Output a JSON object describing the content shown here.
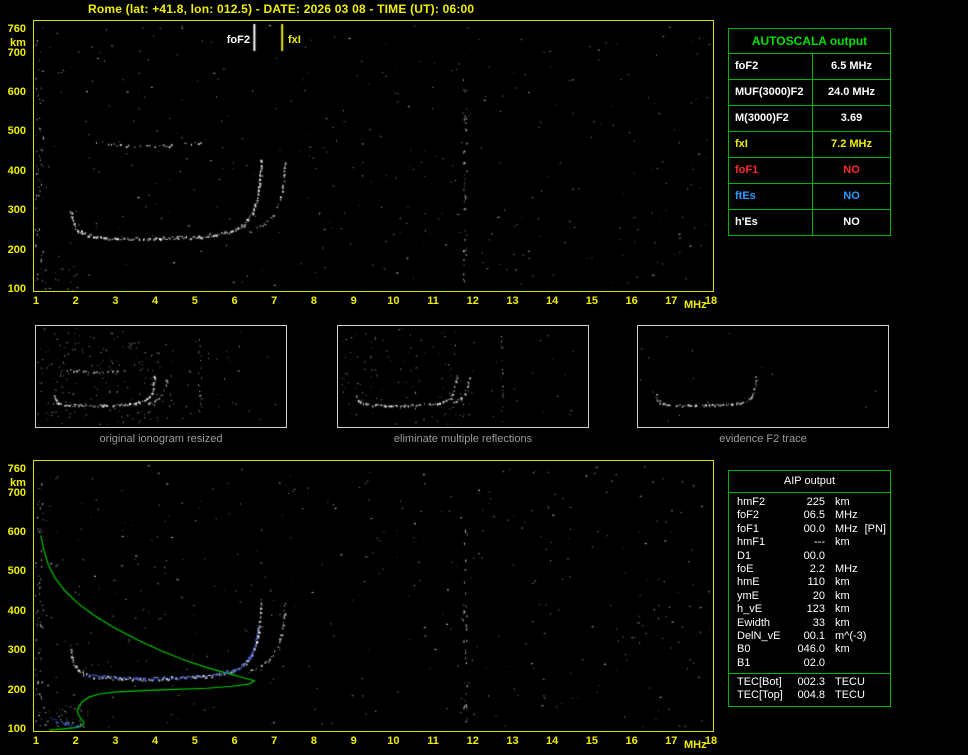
{
  "window": {
    "title": "Rome (lat: +41.8, lon: 012.5) - DATE: 2026 03 08 - TIME (UT): 06:00"
  },
  "colors": {
    "axis_yellow": "#f0f000",
    "panel_border": "#dede00",
    "table_green": "#00b400",
    "trace_white": "#ffffff",
    "profile_green": "#00c800",
    "restored_blue": "#3a5fff",
    "caption_gray": "#9c9c9c"
  },
  "axes": {
    "x_ticks": [
      1,
      2,
      3,
      4,
      5,
      6,
      7,
      8,
      9,
      10,
      11,
      12,
      13,
      14,
      15,
      16,
      17,
      18
    ],
    "x_unit": "MHz",
    "y_ticks": [
      760,
      700,
      600,
      500,
      400,
      300,
      200,
      100
    ],
    "y_unit": "km",
    "x_range": [
      1,
      18
    ],
    "y_range": [
      100,
      760
    ]
  },
  "autoscala": {
    "title": "AUTOSCALA output",
    "rows": [
      {
        "label": "foF2",
        "value": "6.5 MHz",
        "color": "#ffffff"
      },
      {
        "label": "MUF(3000)F2",
        "value": "24.0 MHz",
        "color": "#ffffff"
      },
      {
        "label": "M(3000)F2",
        "value": "3.69",
        "color": "#ffffff"
      },
      {
        "label": "fxI",
        "value": "7.2 MHz",
        "color": "#f0f000"
      },
      {
        "label": "foF1",
        "value": "NO",
        "color": "#ff2a2a"
      },
      {
        "label": "ftEs",
        "value": "NO",
        "color": "#2e9bff"
      },
      {
        "label": "h'Es",
        "value": "NO",
        "color": "#ffffff"
      }
    ]
  },
  "thumbnails": [
    {
      "caption": "original ionogram resized"
    },
    {
      "caption": "eliminate multiple reflections"
    },
    {
      "caption": "evidence F2 trace"
    }
  ],
  "aip": {
    "title": "AIP output",
    "rows": [
      {
        "name": "hmF2",
        "value": "225",
        "unit": "km",
        "extra": ""
      },
      {
        "name": "foF2",
        "value": "06.5",
        "unit": "MHz",
        "extra": ""
      },
      {
        "name": "foF1",
        "value": "00.0",
        "unit": "MHz",
        "extra": "[PN]"
      },
      {
        "name": "hmF1",
        "value": "---",
        "unit": "km",
        "extra": ""
      },
      {
        "name": "D1",
        "value": "00.0",
        "unit": "",
        "extra": ""
      },
      {
        "name": "foE",
        "value": "2.2",
        "unit": "MHz",
        "extra": ""
      },
      {
        "name": "hmE",
        "value": "110",
        "unit": "km",
        "extra": ""
      },
      {
        "name": "ymE",
        "value": "20",
        "unit": "km",
        "extra": ""
      },
      {
        "name": "h_vE",
        "value": "123",
        "unit": "km",
        "extra": ""
      },
      {
        "name": "Ewidth",
        "value": "33",
        "unit": "km",
        "extra": ""
      },
      {
        "name": "DelN_vE",
        "value": "00.1",
        "unit": "m^(-3)",
        "extra": ""
      },
      {
        "name": "B0",
        "value": "046.0",
        "unit": "km",
        "extra": ""
      },
      {
        "name": "B1",
        "value": "02.0",
        "unit": "",
        "extra": ""
      }
    ],
    "tec_rows": [
      {
        "name": "TEC[Bot]",
        "value": "002.3",
        "unit": "TECU"
      },
      {
        "name": "TEC[Top]",
        "value": "004.8",
        "unit": "TECU"
      }
    ]
  },
  "chart_data": {
    "type": "scatter",
    "xlabel": "MHz",
    "ylabel": "km",
    "x_range": [
      1,
      18
    ],
    "y_range": [
      100,
      760
    ],
    "markers": {
      "foF2": {
        "label": "foF2",
        "mhz": 6.5
      },
      "fxI": {
        "label": "fxI",
        "mhz": 7.2
      }
    },
    "interference_mhz": 11.8,
    "f2_trace": [
      [
        1.85,
        302
      ],
      [
        1.95,
        268
      ],
      [
        2.05,
        252
      ],
      [
        2.2,
        243
      ],
      [
        2.45,
        237
      ],
      [
        2.8,
        234
      ],
      [
        3.2,
        232
      ],
      [
        3.7,
        231
      ],
      [
        4.2,
        232
      ],
      [
        4.7,
        234
      ],
      [
        5.1,
        236
      ],
      [
        5.45,
        240
      ],
      [
        5.75,
        246
      ],
      [
        6.0,
        254
      ],
      [
        6.18,
        264
      ],
      [
        6.32,
        277
      ],
      [
        6.43,
        294
      ],
      [
        6.51,
        315
      ],
      [
        6.57,
        340
      ],
      [
        6.61,
        367
      ],
      [
        6.64,
        396
      ],
      [
        6.66,
        425
      ],
      [
        6.67,
        435
      ]
    ],
    "x_mode_trace": [
      [
        6.35,
        248
      ],
      [
        6.55,
        257
      ],
      [
        6.75,
        269
      ],
      [
        6.92,
        286
      ],
      [
        7.05,
        308
      ],
      [
        7.14,
        334
      ],
      [
        7.2,
        363
      ],
      [
        7.24,
        394
      ],
      [
        7.26,
        424
      ]
    ],
    "second_hop_trace": [
      [
        2.5,
        478
      ],
      [
        2.9,
        471
      ],
      [
        3.4,
        467
      ],
      [
        3.9,
        466
      ],
      [
        4.4,
        468
      ],
      [
        4.9,
        472
      ],
      [
        5.3,
        478
      ]
    ],
    "profile": [
      [
        1.12,
        594
      ],
      [
        1.2,
        556
      ],
      [
        1.31,
        520
      ],
      [
        1.48,
        486
      ],
      [
        1.72,
        454
      ],
      [
        2.05,
        422
      ],
      [
        2.45,
        392
      ],
      [
        2.95,
        361
      ],
      [
        3.55,
        329
      ],
      [
        4.15,
        301
      ],
      [
        4.75,
        277
      ],
      [
        5.35,
        257
      ],
      [
        5.85,
        243
      ],
      [
        6.25,
        232
      ],
      [
        6.5,
        225
      ],
      [
        6.38,
        217
      ],
      [
        5.95,
        211
      ],
      [
        5.3,
        206
      ],
      [
        4.5,
        203
      ],
      [
        3.7,
        200
      ],
      [
        3.05,
        197
      ],
      [
        2.62,
        192
      ],
      [
        2.35,
        184
      ],
      [
        2.18,
        173
      ],
      [
        2.08,
        160
      ],
      [
        2.04,
        148
      ],
      [
        2.07,
        138
      ],
      [
        2.13,
        129
      ],
      [
        2.19,
        122
      ],
      [
        2.21,
        116
      ],
      [
        2.15,
        110
      ],
      [
        2.0,
        106
      ],
      [
        1.7,
        103
      ],
      [
        1.35,
        100
      ]
    ],
    "restored_trace": [
      [
        2.25,
        241
      ],
      [
        2.6,
        237
      ],
      [
        3.0,
        234
      ],
      [
        3.5,
        232
      ],
      [
        4.0,
        232
      ],
      [
        4.5,
        233
      ],
      [
        5.0,
        236
      ],
      [
        5.4,
        240
      ],
      [
        5.7,
        245
      ],
      [
        5.95,
        252
      ],
      [
        6.15,
        262
      ],
      [
        6.3,
        276
      ],
      [
        6.42,
        294
      ],
      [
        6.5,
        316
      ],
      [
        6.56,
        342
      ],
      [
        6.6,
        368
      ]
    ],
    "restored_e_trace": [
      [
        1.35,
        130
      ],
      [
        1.5,
        123
      ],
      [
        1.7,
        117
      ],
      [
        1.92,
        113
      ],
      [
        2.08,
        111
      ]
    ]
  }
}
